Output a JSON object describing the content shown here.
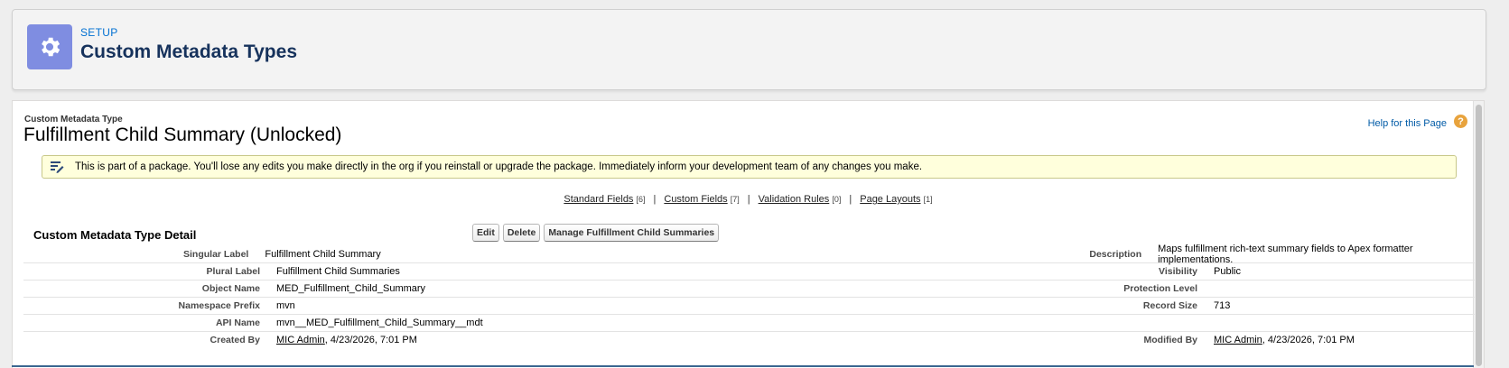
{
  "header": {
    "eyebrow": "SETUP",
    "title": "Custom Metadata Types",
    "icon": "gear-icon"
  },
  "object": {
    "type_label": "Custom Metadata Type",
    "title": "Fulfillment Child Summary (Unlocked)",
    "help_link": "Help for this Page"
  },
  "warning": {
    "text": "This is part of a package. You'll lose any edits you make directly in the org if you reinstall or upgrade the package. Immediately inform your development team of any changes you make."
  },
  "related_links": [
    {
      "label": "Standard Fields",
      "count": "[6]"
    },
    {
      "label": "Custom Fields",
      "count": "[7]"
    },
    {
      "label": "Validation Rules",
      "count": "[0]"
    },
    {
      "label": "Page Layouts",
      "count": "[1]"
    }
  ],
  "separator": "|",
  "detail": {
    "section_title": "Custom Metadata Type Detail",
    "buttons": {
      "edit": "Edit",
      "delete": "Delete",
      "manage": "Manage Fulfillment Child Summaries"
    },
    "rows": [
      {
        "l1": "Singular Label",
        "v1": "Fulfillment Child Summary",
        "l2": "Description",
        "v2": "Maps fulfillment rich-text summary fields to Apex formatter implementations."
      },
      {
        "l1": "Plural Label",
        "v1": "Fulfillment Child Summaries",
        "l2": "Visibility",
        "v2": "Public"
      },
      {
        "l1": "Object Name",
        "v1": "MED_Fulfillment_Child_Summary",
        "l2": "Protection Level",
        "v2": ""
      },
      {
        "l1": "Namespace Prefix",
        "v1": "mvn",
        "l2": "Record Size",
        "v2": "713"
      },
      {
        "l1": "API Name",
        "v1": "mvn__MED_Fulfillment_Child_Summary__mdt",
        "l2": "",
        "v2": ""
      }
    ],
    "created": {
      "label": "Created By",
      "user": "MIC Admin",
      "date": ", 4/23/2026, 7:01 PM"
    },
    "modified": {
      "label": "Modified By",
      "user": "MIC Admin",
      "date": ", 4/23/2026, 7:01 PM"
    }
  },
  "colors": {
    "header_icon_bg": "#7f8de1",
    "link_blue": "#0070d2",
    "warning_bg": "#ffffdc"
  }
}
